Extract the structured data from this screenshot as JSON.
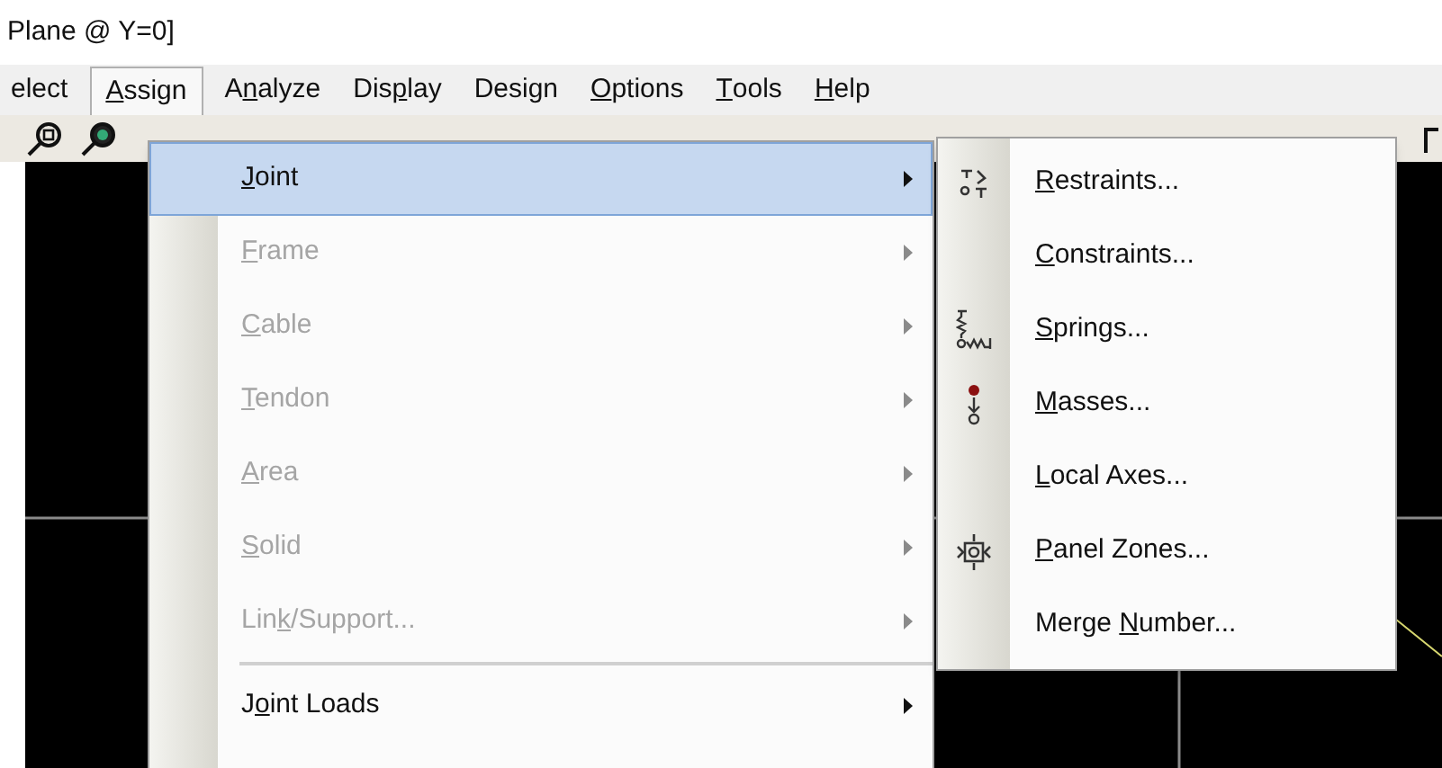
{
  "window": {
    "title": "Plane @ Y=0]"
  },
  "menu_bar": [
    {
      "post": "elect",
      "selected": false
    },
    {
      "key": "A",
      "post": "ssign",
      "selected": true
    },
    {
      "pre": "A",
      "key": "n",
      "post": "alyze",
      "selected": false
    },
    {
      "pre": "Dis",
      "key": "p",
      "post": "lay",
      "selected": false
    },
    {
      "pre": "Design",
      "selected": false
    },
    {
      "key": "O",
      "post": "ptions",
      "selected": false
    },
    {
      "key": "T",
      "post": "ools",
      "selected": false
    },
    {
      "key": "H",
      "post": "elp",
      "selected": false
    }
  ],
  "menu": {
    "items": [
      {
        "kind": "item",
        "key": "J",
        "post": "oint",
        "selected": true,
        "disabled": false,
        "submenu": true
      },
      {
        "kind": "item",
        "key": "F",
        "post": "rame",
        "selected": false,
        "disabled": true,
        "submenu": true
      },
      {
        "kind": "item",
        "key": "C",
        "post": "able",
        "selected": false,
        "disabled": true,
        "submenu": true
      },
      {
        "kind": "item",
        "key": "T",
        "post": "endon",
        "selected": false,
        "disabled": true,
        "submenu": true
      },
      {
        "kind": "item",
        "key": "A",
        "post": "rea",
        "selected": false,
        "disabled": true,
        "submenu": true
      },
      {
        "kind": "item",
        "key": "S",
        "post": "olid",
        "selected": false,
        "disabled": true,
        "submenu": true
      },
      {
        "kind": "item",
        "pre": "Lin",
        "key": "k",
        "post": "/Support...",
        "selected": false,
        "disabled": true,
        "submenu": true
      },
      {
        "kind": "separator"
      },
      {
        "kind": "item",
        "pre": "J",
        "key": "o",
        "post": "int Loads",
        "selected": false,
        "disabled": false,
        "submenu": true
      }
    ]
  },
  "submenu": {
    "items": [
      {
        "kind": "restraint",
        "key": "R",
        "post": "estraints..."
      },
      {
        "kind": "plain",
        "key": "C",
        "post": "onstraints..."
      },
      {
        "kind": "spring",
        "key": "S",
        "post": "prings..."
      },
      {
        "kind": "mass",
        "key": "M",
        "post": "asses..."
      },
      {
        "kind": "plain",
        "key": "L",
        "post": "ocal Axes..."
      },
      {
        "kind": "panel",
        "key": "P",
        "post": "anel Zones..."
      },
      {
        "kind": "plain",
        "pre": "Merge ",
        "key": "N",
        "post": "umber..."
      }
    ]
  }
}
